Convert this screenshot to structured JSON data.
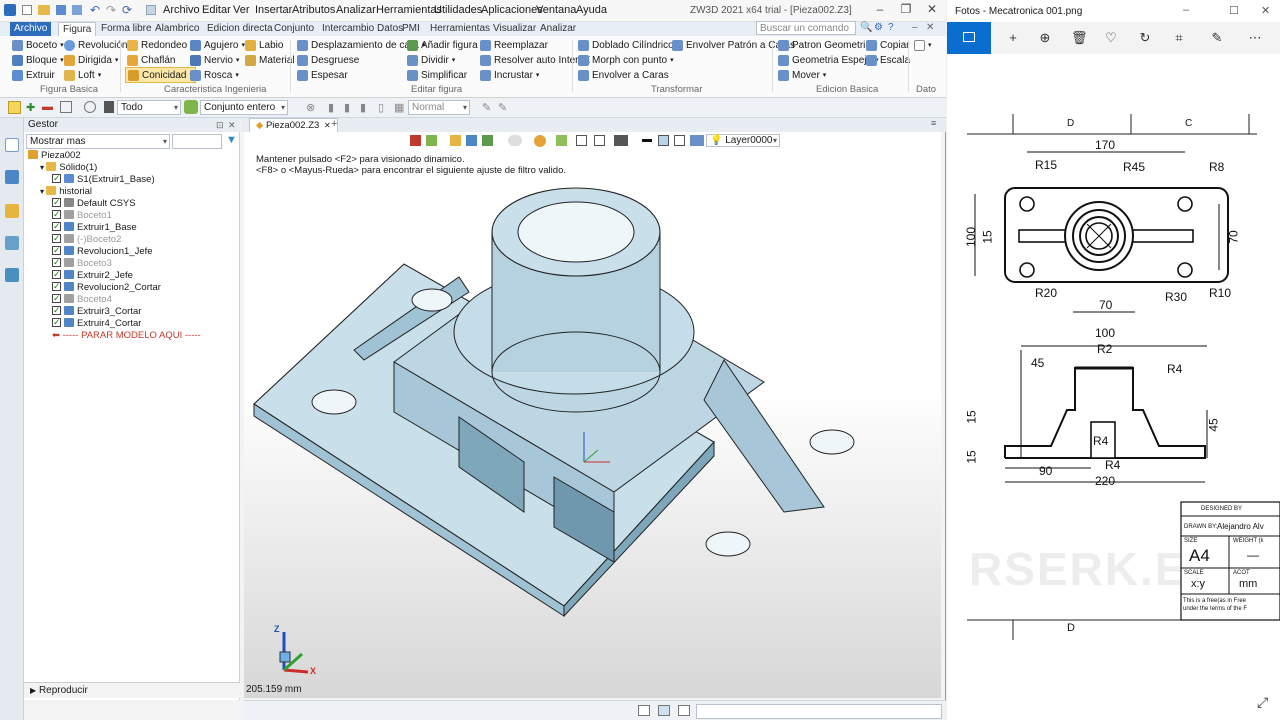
{
  "zw3d": {
    "menu": [
      "Archivo",
      "Editar",
      "Ver",
      "Insertar",
      "Atributos",
      "Analizar",
      "Herramientas",
      "Utilidades",
      "Aplicaciones",
      "Ventana",
      "Ayuda"
    ],
    "title": "ZW3D 2021 x64 trial - [Pieza002.Z3]",
    "search_placeholder": "Buscar un comando",
    "tabs": [
      "Archivo",
      "Figura",
      "Forma libre",
      "Alambrico",
      "Edicion directa",
      "Conjunto",
      "Intercambio Datos",
      "PMI",
      "Herramientas",
      "Visualizar",
      "Analizar"
    ],
    "ribbon": {
      "col1": [
        "Boceto",
        "Bloque",
        "Extruir"
      ],
      "col2": [
        "Revolución",
        "Dirigida",
        "Loft"
      ],
      "col3": [
        "Redondeo",
        "Chaflán",
        "Conicidad"
      ],
      "col4": [
        "Agujero",
        "Nervio",
        "Rosca"
      ],
      "col5": [
        "Labio",
        "Material"
      ],
      "col6": [
        "Desplazamiento de cara",
        "Desgruese",
        "Espesar"
      ],
      "col7": [
        "Añadir figura",
        "Dividir",
        "Simplificar"
      ],
      "col8": [
        "Reemplazar",
        "Resolver auto IntersX",
        "Incrustar"
      ],
      "col9": [
        "Doblado Cilíndrico",
        "Morph con punto",
        "Envolver a Caras"
      ],
      "col10": [
        "Envolver Patrón a Caras"
      ],
      "col11": [
        "Patron Geometria",
        "Geometria Espejo",
        "Mover"
      ],
      "col12": [
        "Copiar",
        "Escala"
      ],
      "groups": [
        "Figura Basica",
        "Caracteristica Ingenieria",
        "Editar figura",
        "Transformar",
        "Edicion Basica",
        "Dato"
      ]
    },
    "toolbar2": {
      "filter": "Todo",
      "scope": "Conjunto entero",
      "mode": "Normal"
    },
    "manager": {
      "header": "Gestor",
      "show_more": "Mostrar mas",
      "tree": [
        {
          "label": "Pieza002",
          "indent": 0,
          "kind": "part"
        },
        {
          "label": "Sólido(1)",
          "indent": 1,
          "kind": "folder"
        },
        {
          "label": "S1(Extruir1_Base)",
          "indent": 2,
          "kind": "solid",
          "checked": true
        },
        {
          "label": "historial",
          "indent": 1,
          "kind": "folder"
        },
        {
          "label": "Default CSYS",
          "indent": 2,
          "kind": "csys",
          "checked": true
        },
        {
          "label": "Boceto1",
          "indent": 2,
          "kind": "sketch",
          "checked": true,
          "dim": true
        },
        {
          "label": "Extruir1_Base",
          "indent": 2,
          "kind": "feature",
          "checked": true
        },
        {
          "label": "(-)Boceto2",
          "indent": 2,
          "kind": "sketch",
          "checked": true,
          "dim": true
        },
        {
          "label": "Revolucion1_Jefe",
          "indent": 2,
          "kind": "feature",
          "checked": true
        },
        {
          "label": "Boceto3",
          "indent": 2,
          "kind": "sketch",
          "checked": true,
          "dim": true
        },
        {
          "label": "Extruir2_Jefe",
          "indent": 2,
          "kind": "feature",
          "checked": true
        },
        {
          "label": "Revolucion2_Cortar",
          "indent": 2,
          "kind": "feature",
          "checked": true
        },
        {
          "label": "Boceto4",
          "indent": 2,
          "kind": "sketch",
          "checked": true,
          "dim": true
        },
        {
          "label": "Extruir3_Cortar",
          "indent": 2,
          "kind": "feature",
          "checked": true
        },
        {
          "label": "Extruir4_Cortar",
          "indent": 2,
          "kind": "feature",
          "checked": true
        },
        {
          "label": "----- PARAR MODELO AQUI -----",
          "indent": 2,
          "kind": "stop"
        }
      ],
      "footer": "Reproducir"
    },
    "viewport": {
      "doc_tab": "Pieza002.Z3",
      "layer": "Layer0000",
      "hint1": "Mantener pulsado <F2> para visionado dinamico.",
      "hint2": "<F8> o <Mayus-Rueda> para encontrar el siguiente ajuste de filtro valido.",
      "measure": "205.159 mm",
      "axis_x": "X"
    }
  },
  "photos": {
    "title": "Fotos - Mecatronica 001.png",
    "drawing": {
      "top_view": {
        "dims": [
          "170",
          "R15",
          "R45",
          "R8",
          "100",
          "15",
          "70",
          "R20",
          "70",
          "R30",
          "R10"
        ]
      },
      "front_view": {
        "dims": [
          "100",
          "R2",
          "45",
          "R4",
          "15",
          "45",
          "15",
          "R4",
          "R4",
          "90",
          "220"
        ]
      },
      "zone_letters": [
        "D",
        "C",
        "D"
      ],
      "title_block": {
        "designed_by": "DESIGNED BY",
        "drawn_by_label": "DRAWN BY:",
        "drawn_by": "Alejandro Alv",
        "size_label": "SIZE",
        "size": "A4",
        "weight_label": "WEIGHT (k",
        "weight": "—",
        "scale_label": "SCALE",
        "scale": "x:y",
        "unit_label": "ACOT",
        "unit": "mm",
        "license_line1": "This is a free(as in Free",
        "license_line2": "under the terms of the F"
      },
      "watermark": "RSERK.E"
    }
  }
}
